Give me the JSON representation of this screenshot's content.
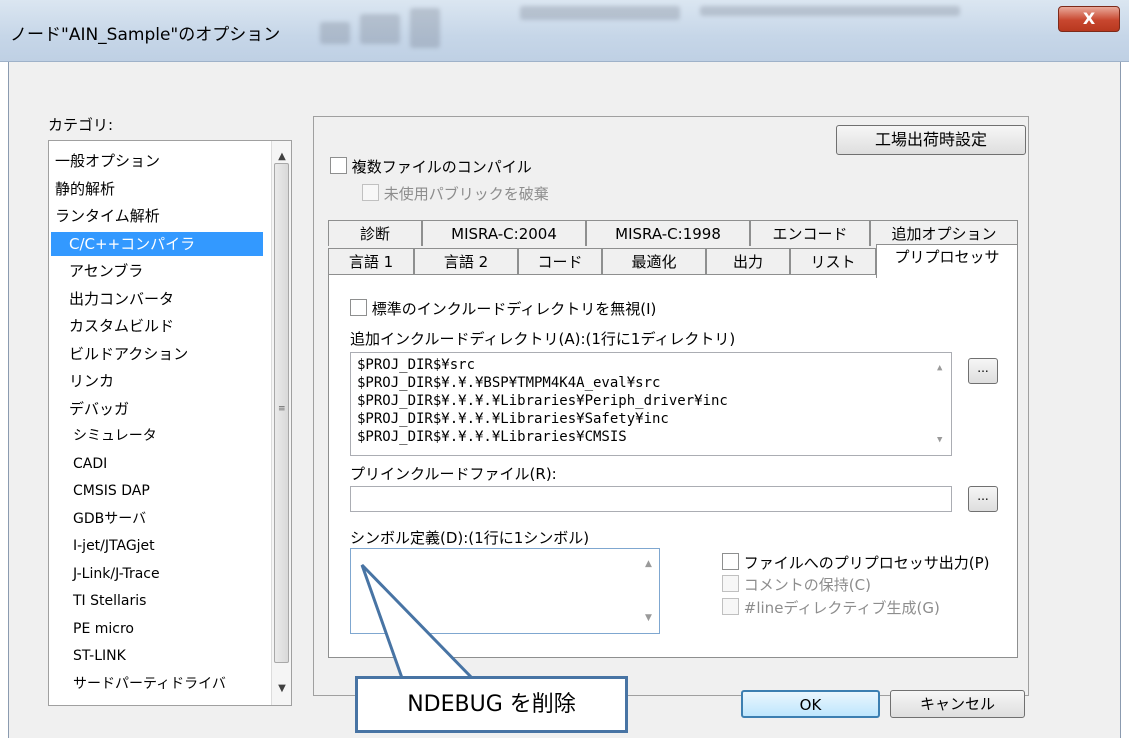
{
  "window": {
    "title": "ノード\"AIN_Sample\"のオプション",
    "close_label": "X"
  },
  "categories": {
    "label": "カテゴリ:",
    "items": [
      {
        "label": "一般オプション",
        "level": 1
      },
      {
        "label": "静的解析",
        "level": 1
      },
      {
        "label": "ランタイム解析",
        "level": 1
      },
      {
        "label": "C/C++コンパイラ",
        "level": 2,
        "selected": true
      },
      {
        "label": "アセンブラ",
        "level": 2
      },
      {
        "label": "出力コンバータ",
        "level": 2
      },
      {
        "label": "カスタムビルド",
        "level": 2
      },
      {
        "label": "ビルドアクション",
        "level": 2
      },
      {
        "label": "リンカ",
        "level": 2
      },
      {
        "label": "デバッガ",
        "level": 2
      },
      {
        "label": "シミュレータ",
        "level": 3
      },
      {
        "label": "CADI",
        "level": 3
      },
      {
        "label": "CMSIS DAP",
        "level": 3
      },
      {
        "label": "GDBサーバ",
        "level": 3
      },
      {
        "label": "I-jet/JTAGjet",
        "level": 3
      },
      {
        "label": "J-Link/J-Trace",
        "level": 3
      },
      {
        "label": "TI Stellaris",
        "level": 3
      },
      {
        "label": "PE micro",
        "level": 3
      },
      {
        "label": "ST-LINK",
        "level": 3
      },
      {
        "label": "サードパーティドライバ",
        "level": 3
      }
    ]
  },
  "panel": {
    "factory_settings": "工場出荷時設定",
    "multi_file": "複数ファイルのコンパイル",
    "discard_public": "未使用パブリックを破棄",
    "tabs_row1": [
      "診断",
      "MISRA-C:2004",
      "MISRA-C:1998",
      "エンコード",
      "追加オプション"
    ],
    "tabs_row2": [
      "言語 1",
      "言語 2",
      "コード",
      "最適化",
      "出力",
      "リスト",
      "プリプロセッサ"
    ],
    "active_tab": "プリプロセッサ",
    "ignore_std_include": "標準のインクルードディレクトリを無視(I)",
    "additional_include_label": "追加インクルードディレクトリ(A):(1行に1ディレクトリ)",
    "include_dirs": [
      "$PROJ_DIR$¥src",
      "$PROJ_DIR$¥.¥.¥BSP¥TMPM4K4A_eval¥src",
      "$PROJ_DIR$¥.¥.¥.¥Libraries¥Periph_driver¥inc",
      "$PROJ_DIR$¥.¥.¥.¥Libraries¥Safety¥inc",
      "$PROJ_DIR$¥.¥.¥.¥Libraries¥CMSIS"
    ],
    "preinclude_label": "プリインクルードファイル(R):",
    "preinclude_value": "",
    "symbols_label": "シンボル定義(D):(1行に1シンボル)",
    "symbols_value": "",
    "preprocess_to_file": "ファイルへのプリプロセッサ出力(P)",
    "keep_comments": "コメントの保持(C)",
    "generate_line": "#lineディレクティブ生成(G)",
    "browse_label": "..."
  },
  "buttons": {
    "ok": "OK",
    "cancel": "キャンセル"
  },
  "callout": {
    "text": "NDEBUG を削除"
  },
  "colors": {
    "selection": "#3399ff",
    "callout_border": "#4874a4"
  }
}
